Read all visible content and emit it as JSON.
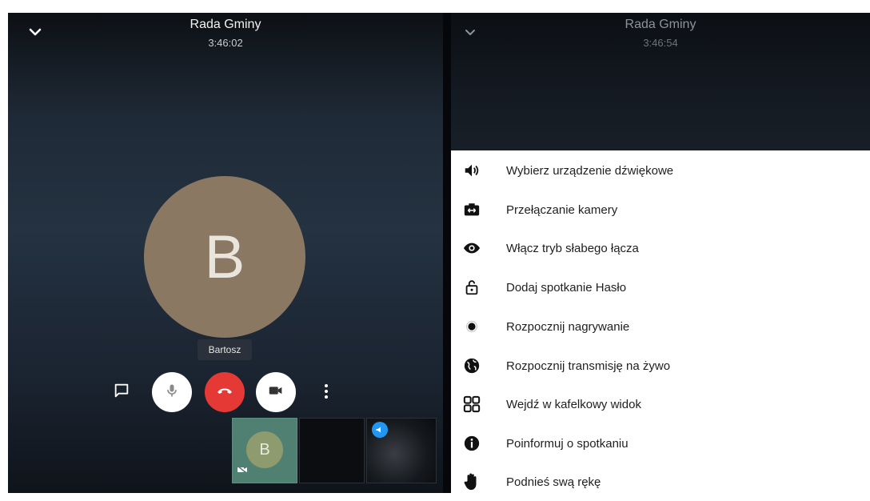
{
  "left_panel": {
    "title": "Rada Gminy",
    "time": "3:46:02",
    "avatar_letter": "B",
    "participant_name": "Bartosz",
    "self_thumb_letter": "B",
    "icons": {
      "collapse": "chevron-down-icon",
      "chat": "chat-icon",
      "microphone": "microphone-icon",
      "hangup": "hangup-icon",
      "camera": "video-camera-icon",
      "more": "more-vertical-icon",
      "camera_off_badge": "camera-off-icon",
      "megaphone_badge": "megaphone-icon"
    }
  },
  "right_panel": {
    "title": "Rada Gminy",
    "time": "3:46:54",
    "menu_items": [
      {
        "label": "Wybierz urządzenie dźwiękowe",
        "icon": "volume-icon"
      },
      {
        "label": "Przełączanie kamery",
        "icon": "switch-camera-icon"
      },
      {
        "label": "Włącz tryb słabego łącza",
        "icon": "eye-icon"
      },
      {
        "label": "Dodaj spotkanie Hasło",
        "icon": "unlock-icon"
      },
      {
        "label": "Rozpocznij nagrywanie",
        "icon": "record-icon"
      },
      {
        "label": "Rozpocznij transmisję na żywo",
        "icon": "globe-icon"
      },
      {
        "label": "Wejdź w kafelkowy widok",
        "icon": "tile-view-icon"
      },
      {
        "label": "Poinformuj o spotkaniu",
        "icon": "info-icon"
      },
      {
        "label": "Podnieś swą rękę",
        "icon": "raise-hand-icon"
      }
    ]
  },
  "colors": {
    "hangup": "#e53935",
    "avatar": "#8a7862",
    "self_thumb": "#4f8072",
    "badge_blue": "#2196f3"
  }
}
